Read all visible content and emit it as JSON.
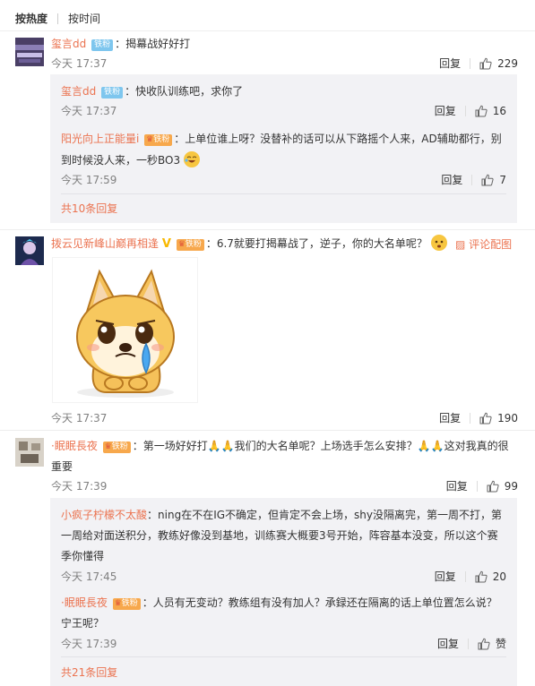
{
  "sort": {
    "active": "按热度",
    "other": "按时间"
  },
  "actions": {
    "reply": "回复",
    "like_word": "赞"
  },
  "comments": [
    {
      "author": "玺言dd",
      "badge": "铁粉",
      "text": "揭幕战好好打",
      "time": "今天 17:37",
      "likes": "229",
      "replies": [
        {
          "author": "玺言dd",
          "badge": "铁粉",
          "text": "快收队训练吧，求你了",
          "time": "今天 17:37",
          "likes": "16"
        },
        {
          "author": "阳光向上正能量i",
          "badge": "铁粉",
          "text_line1": "上单位谁上呀？没替补的话可以从下路摇个人来，AD辅助都行，别",
          "text_line2": "到时候没人来，一秒BO3",
          "time": "今天 17:59",
          "likes": "7"
        }
      ],
      "more_replies": "共10条回复"
    },
    {
      "author": "拨云见新峰山巅再相逢",
      "badge": "铁粉",
      "text": "6.7就要打揭幕战了，逆子，你的大名单呢？",
      "pic_link": "评论配图",
      "time": "今天 17:37",
      "likes": "190"
    },
    {
      "author": "·眠眠長夜",
      "badge": "铁粉",
      "text_a": "第一场好好打",
      "text_b": "我们的大名单呢？上场选手怎么安排？",
      "text_c": "这对我真的很",
      "text_line2": "重要",
      "time": "今天 17:39",
      "likes": "99",
      "replies": [
        {
          "author": "小疯子柠檬不太酸",
          "text_line1": "ning在不在IG不确定，但肯定不会上场，shy没隔离完，第一周不打，第",
          "text_line2": "一周给对面送积分，教练好像没到基地，训练赛大概要3号开始，阵容基本没变，所以这个赛",
          "text_line3": "季你懂得",
          "time": "今天 17:45",
          "likes": "20"
        },
        {
          "author": "·眠眠長夜",
          "badge": "铁粉",
          "text_line1": "人员有无变动？教练组有没有加人？承録还在隔离的话上单位置怎么说？",
          "text_line2": "宁王呢？",
          "time": "今天 17:39"
        }
      ],
      "more_replies": "共21条回复"
    }
  ]
}
